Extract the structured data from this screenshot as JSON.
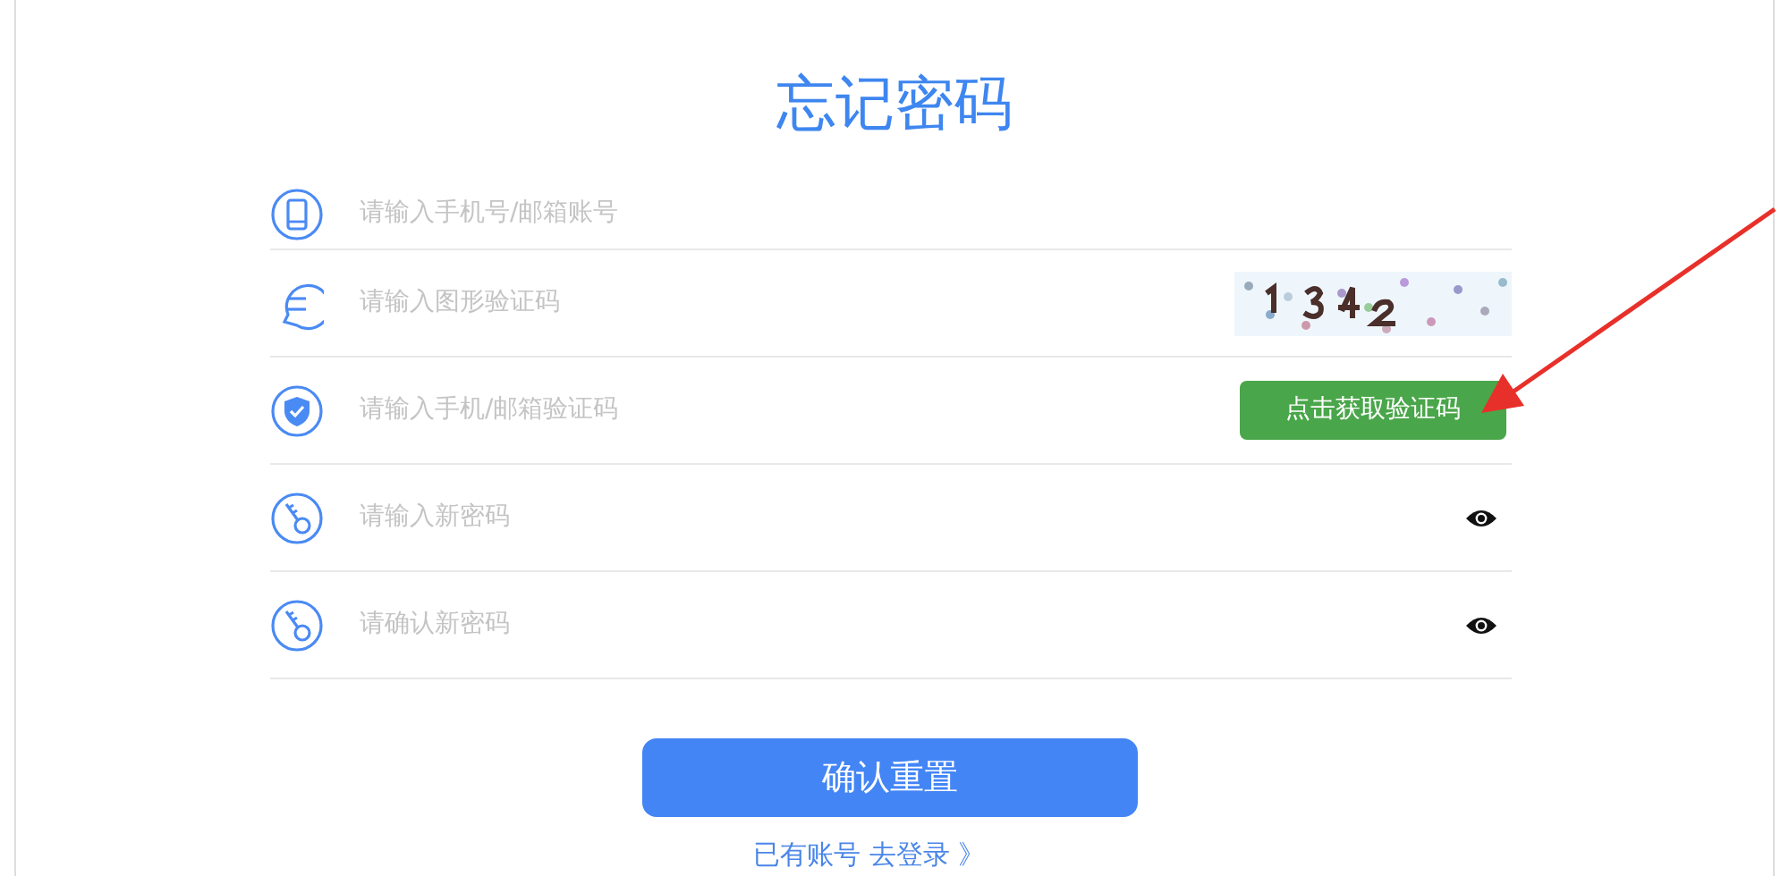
{
  "title": "忘记密码",
  "fields": [
    {
      "kind": "account",
      "placeholder": "请输入手机号/邮箱账号"
    },
    {
      "kind": "captcha",
      "placeholder": "请输入图形验证码"
    },
    {
      "kind": "code",
      "placeholder": "请输入手机/邮箱验证码",
      "button": "点击获取验证码"
    },
    {
      "kind": "password",
      "placeholder": "请输入新密码"
    },
    {
      "kind": "password",
      "placeholder": "请确认新密码"
    }
  ],
  "submit_button": "确认重置",
  "login_link": "已有账号 去登录 》"
}
